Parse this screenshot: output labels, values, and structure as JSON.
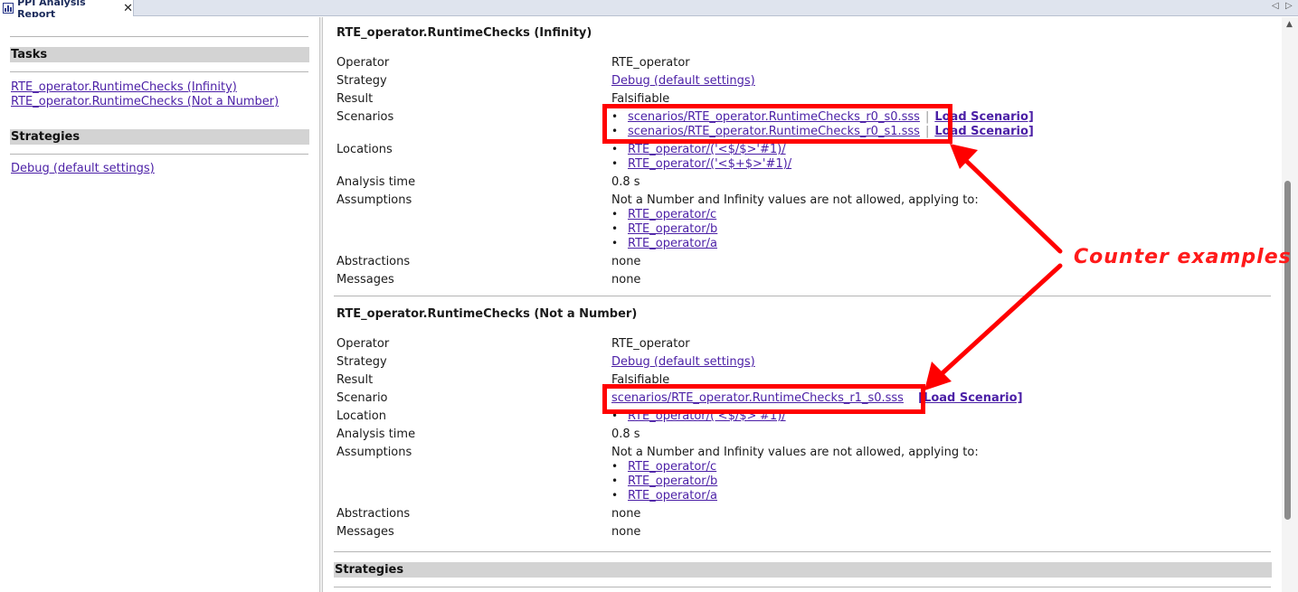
{
  "tab": {
    "title": "PPI Analysis Report",
    "close_glyph": "✕",
    "nav_left": "◁",
    "nav_right": "▷"
  },
  "sidebar": {
    "tasks_heading": "Tasks",
    "tasks": [
      {
        "label": "RTE_operator.RuntimeChecks (Infinity)"
      },
      {
        "label": "RTE_operator.RuntimeChecks (Not a Number)"
      }
    ],
    "strategies_heading": "Strategies",
    "strategies": [
      {
        "label": "Debug (default settings)"
      }
    ]
  },
  "report": {
    "tasks": [
      {
        "title": "RTE_operator.RuntimeChecks (Infinity)",
        "labels": {
          "operator": "Operator",
          "strategy": "Strategy",
          "result": "Result",
          "scenarios": "Scenarios",
          "locations": "Locations",
          "analysis_time": "Analysis time",
          "assumptions": "Assumptions",
          "abstractions": "Abstractions",
          "messages": "Messages"
        },
        "operator": "RTE_operator",
        "strategy": "Debug (default settings)",
        "result": "Falsifiable",
        "scenarios": [
          {
            "file": "scenarios/RTE_operator.RuntimeChecks_r0_s0.sss",
            "sep": "|",
            "load": "Load Scenario]"
          },
          {
            "file": "scenarios/RTE_operator.RuntimeChecks_r0_s1.sss",
            "sep": "|",
            "load": "Load Scenario]"
          }
        ],
        "locations": [
          "RTE_operator/('<$/$>'#1)/",
          "RTE_operator/('<$+$>'#1)/"
        ],
        "analysis_time": "0.8 s",
        "assumptions_text": "Not a Number and Infinity values are not allowed, applying to:",
        "assumption_targets": [
          "RTE_operator/c",
          "RTE_operator/b",
          "RTE_operator/a"
        ],
        "abstractions": "none",
        "messages": "none"
      },
      {
        "title": "RTE_operator.RuntimeChecks (Not a Number)",
        "labels": {
          "operator": "Operator",
          "strategy": "Strategy",
          "result": "Result",
          "scenario": "Scenario",
          "location": "Location",
          "analysis_time": "Analysis time",
          "assumptions": "Assumptions",
          "abstractions": "Abstractions",
          "messages": "Messages"
        },
        "operator": "RTE_operator",
        "strategy": "Debug (default settings)",
        "result": "Falsifiable",
        "scenario": {
          "file": "scenarios/RTE_operator.RuntimeChecks_r1_s0.sss",
          "load": "[Load Scenario]"
        },
        "location": "RTE_operator/('<$/$>'#1)/",
        "analysis_time": "0.8 s",
        "assumptions_text": "Not a Number and Infinity values are not allowed, applying to:",
        "assumption_targets": [
          "RTE_operator/c",
          "RTE_operator/b",
          "RTE_operator/a"
        ],
        "abstractions": "none",
        "messages": "none"
      }
    ],
    "strategies_heading": "Strategies"
  },
  "annotation": {
    "text": "Counter examples",
    "color": "#ff0000"
  },
  "bullet_glyph": "•"
}
